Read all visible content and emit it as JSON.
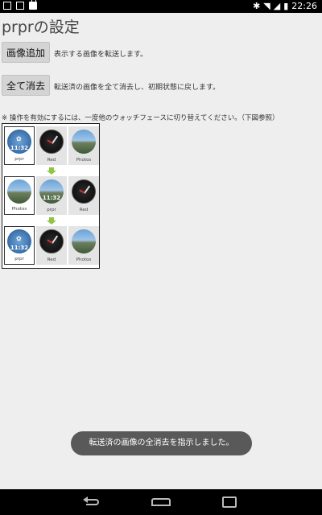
{
  "status_bar": {
    "time": "22:26",
    "left_icons": [
      "square-outline-icon",
      "square-outline-icon",
      "shopping-bag-icon"
    ],
    "right_icons": [
      "bluetooth-icon",
      "wifi-icon",
      "signal-icon",
      "battery-icon"
    ]
  },
  "page": {
    "title": "prprの設定",
    "add_button": "画像追加",
    "add_description": "表示する画像を転送します。",
    "clear_button": "全て消去",
    "clear_description": "転送済の画像を全て消去し、初期状態に戻します。",
    "note": "※ 操作を有効にするには、一度他のウォッチフェースに切り替えてください。（下図参照）"
  },
  "diagram": {
    "rows": [
      [
        {
          "label": "prpr",
          "face": "prpr",
          "time": "11:32",
          "selected": true
        },
        {
          "label": "Red",
          "face": "red",
          "time": "",
          "selected": false
        },
        {
          "label": "Photos",
          "face": "photo",
          "time": "",
          "selected": false
        }
      ],
      [
        {
          "label": "Photos",
          "face": "photo",
          "time": "",
          "selected": true
        },
        {
          "label": "prpr",
          "face": "photo",
          "time": "11:32",
          "selected": false
        },
        {
          "label": "Red",
          "face": "red",
          "time": "",
          "selected": false
        }
      ],
      [
        {
          "label": "prpr",
          "face": "prpr",
          "time": "11:32",
          "selected": true
        },
        {
          "label": "Red",
          "face": "red",
          "time": "",
          "selected": false
        },
        {
          "label": "Photos",
          "face": "photo",
          "time": "",
          "selected": false
        }
      ]
    ],
    "arrow_color": "#8dc641"
  },
  "toast": {
    "message": "転送済の画像の全消去を指示しました。"
  },
  "nav_bar": {
    "buttons": [
      "back-icon",
      "home-icon",
      "recent-apps-icon"
    ]
  }
}
